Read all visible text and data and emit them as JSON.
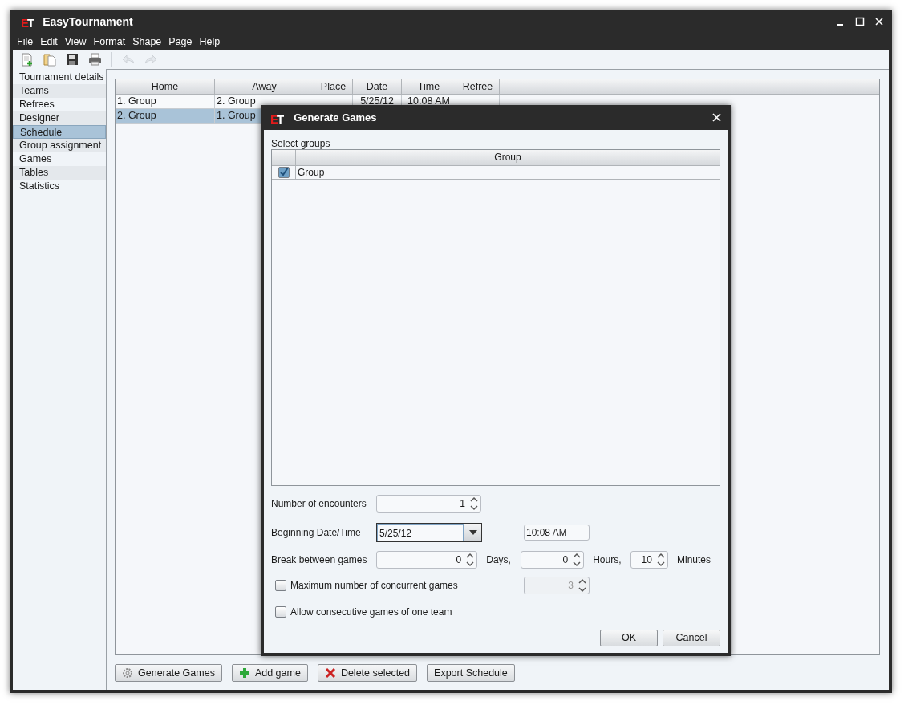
{
  "window": {
    "logo": [
      "E",
      "T"
    ],
    "title": "EasyTournament"
  },
  "menu": [
    "File",
    "Edit",
    "View",
    "Format",
    "Shape",
    "Page",
    "Help"
  ],
  "toolbar": [
    {
      "kind": "new",
      "disabled": false
    },
    {
      "kind": "open",
      "disabled": false
    },
    {
      "kind": "save",
      "disabled": false
    },
    {
      "kind": "print",
      "disabled": false
    },
    {
      "kind": "separator"
    },
    {
      "kind": "undo",
      "disabled": true
    },
    {
      "kind": "redo",
      "disabled": true
    }
  ],
  "sidebar": {
    "items": [
      {
        "label": "Tournament details",
        "selected": false
      },
      {
        "label": "Teams",
        "selected": false
      },
      {
        "label": "Refrees",
        "selected": false
      },
      {
        "label": "Designer",
        "selected": false
      },
      {
        "label": "Schedule",
        "selected": true
      },
      {
        "label": "Group assignment",
        "selected": false
      },
      {
        "label": "Games",
        "selected": false
      },
      {
        "label": "Tables",
        "selected": false
      },
      {
        "label": "Statistics",
        "selected": false
      }
    ]
  },
  "table": {
    "columns": [
      "Home",
      "Away",
      "Place",
      "Date",
      "Time",
      "Refree"
    ],
    "rows": [
      {
        "cells": [
          "1. Group",
          "2. Group",
          "",
          "5/25/12",
          "10:08 AM",
          ""
        ],
        "selected": false
      },
      {
        "cells": [
          "2. Group",
          "1. Group"
        ],
        "selected": true
      }
    ]
  },
  "buttons": [
    {
      "kind": "gear",
      "label": "Generate Games"
    },
    {
      "kind": "plus",
      "label": "Add game"
    },
    {
      "kind": "cross",
      "label": "Delete selected"
    },
    {
      "kind": "none",
      "label": "Export Schedule"
    }
  ],
  "dialog": {
    "logo": [
      "E",
      "T"
    ],
    "title": "Generate Games",
    "groups_label": "Select groups",
    "groups_column": "Group",
    "groups": [
      {
        "label": "Group",
        "checked": true
      }
    ],
    "encounters": {
      "label": "Number of encounters",
      "value": "1"
    },
    "beginning": {
      "label": "Beginning Date/Time",
      "date": "5/25/12",
      "time": "10:08 AM"
    },
    "break": {
      "label": "Break between games",
      "fields": [
        {
          "value": "0",
          "unit": "Days,"
        },
        {
          "value": "0",
          "unit": "Hours,"
        },
        {
          "value": "10",
          "unit": "Minutes"
        }
      ]
    },
    "options": [
      {
        "label": "Maximum number of concurrent games",
        "checked": false,
        "spinner": {
          "value": "3",
          "disabled": true
        }
      },
      {
        "label": "Allow consecutive games of one team",
        "checked": false
      }
    ],
    "buttons": [
      "OK",
      "Cancel"
    ]
  }
}
